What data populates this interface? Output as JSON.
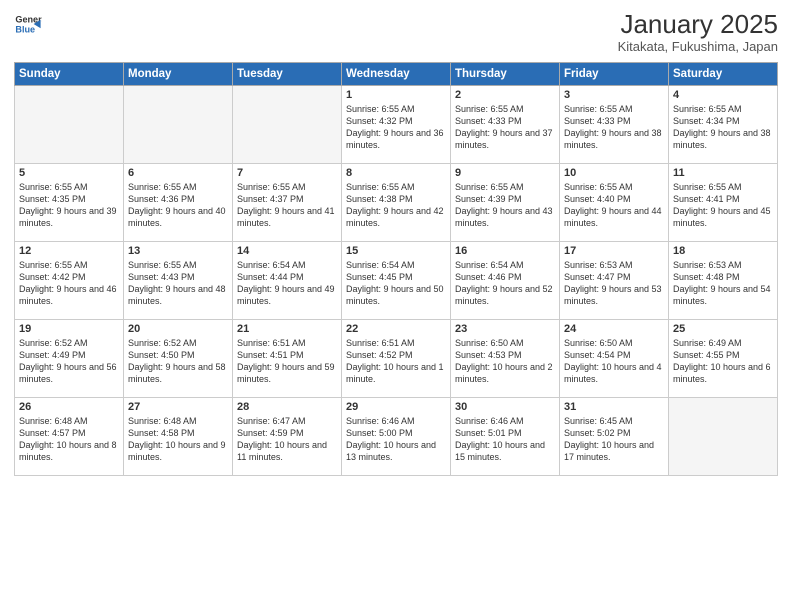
{
  "header": {
    "logo_general": "General",
    "logo_blue": "Blue",
    "title": "January 2025",
    "subtitle": "Kitakata, Fukushima, Japan"
  },
  "days_of_week": [
    "Sunday",
    "Monday",
    "Tuesday",
    "Wednesday",
    "Thursday",
    "Friday",
    "Saturday"
  ],
  "weeks": [
    [
      {
        "day": "",
        "content": ""
      },
      {
        "day": "",
        "content": ""
      },
      {
        "day": "",
        "content": ""
      },
      {
        "day": "1",
        "content": "Sunrise: 6:55 AM\nSunset: 4:32 PM\nDaylight: 9 hours and 36 minutes."
      },
      {
        "day": "2",
        "content": "Sunrise: 6:55 AM\nSunset: 4:33 PM\nDaylight: 9 hours and 37 minutes."
      },
      {
        "day": "3",
        "content": "Sunrise: 6:55 AM\nSunset: 4:33 PM\nDaylight: 9 hours and 38 minutes."
      },
      {
        "day": "4",
        "content": "Sunrise: 6:55 AM\nSunset: 4:34 PM\nDaylight: 9 hours and 38 minutes."
      }
    ],
    [
      {
        "day": "5",
        "content": "Sunrise: 6:55 AM\nSunset: 4:35 PM\nDaylight: 9 hours and 39 minutes."
      },
      {
        "day": "6",
        "content": "Sunrise: 6:55 AM\nSunset: 4:36 PM\nDaylight: 9 hours and 40 minutes."
      },
      {
        "day": "7",
        "content": "Sunrise: 6:55 AM\nSunset: 4:37 PM\nDaylight: 9 hours and 41 minutes."
      },
      {
        "day": "8",
        "content": "Sunrise: 6:55 AM\nSunset: 4:38 PM\nDaylight: 9 hours and 42 minutes."
      },
      {
        "day": "9",
        "content": "Sunrise: 6:55 AM\nSunset: 4:39 PM\nDaylight: 9 hours and 43 minutes."
      },
      {
        "day": "10",
        "content": "Sunrise: 6:55 AM\nSunset: 4:40 PM\nDaylight: 9 hours and 44 minutes."
      },
      {
        "day": "11",
        "content": "Sunrise: 6:55 AM\nSunset: 4:41 PM\nDaylight: 9 hours and 45 minutes."
      }
    ],
    [
      {
        "day": "12",
        "content": "Sunrise: 6:55 AM\nSunset: 4:42 PM\nDaylight: 9 hours and 46 minutes."
      },
      {
        "day": "13",
        "content": "Sunrise: 6:55 AM\nSunset: 4:43 PM\nDaylight: 9 hours and 48 minutes."
      },
      {
        "day": "14",
        "content": "Sunrise: 6:54 AM\nSunset: 4:44 PM\nDaylight: 9 hours and 49 minutes."
      },
      {
        "day": "15",
        "content": "Sunrise: 6:54 AM\nSunset: 4:45 PM\nDaylight: 9 hours and 50 minutes."
      },
      {
        "day": "16",
        "content": "Sunrise: 6:54 AM\nSunset: 4:46 PM\nDaylight: 9 hours and 52 minutes."
      },
      {
        "day": "17",
        "content": "Sunrise: 6:53 AM\nSunset: 4:47 PM\nDaylight: 9 hours and 53 minutes."
      },
      {
        "day": "18",
        "content": "Sunrise: 6:53 AM\nSunset: 4:48 PM\nDaylight: 9 hours and 54 minutes."
      }
    ],
    [
      {
        "day": "19",
        "content": "Sunrise: 6:52 AM\nSunset: 4:49 PM\nDaylight: 9 hours and 56 minutes."
      },
      {
        "day": "20",
        "content": "Sunrise: 6:52 AM\nSunset: 4:50 PM\nDaylight: 9 hours and 58 minutes."
      },
      {
        "day": "21",
        "content": "Sunrise: 6:51 AM\nSunset: 4:51 PM\nDaylight: 9 hours and 59 minutes."
      },
      {
        "day": "22",
        "content": "Sunrise: 6:51 AM\nSunset: 4:52 PM\nDaylight: 10 hours and 1 minute."
      },
      {
        "day": "23",
        "content": "Sunrise: 6:50 AM\nSunset: 4:53 PM\nDaylight: 10 hours and 2 minutes."
      },
      {
        "day": "24",
        "content": "Sunrise: 6:50 AM\nSunset: 4:54 PM\nDaylight: 10 hours and 4 minutes."
      },
      {
        "day": "25",
        "content": "Sunrise: 6:49 AM\nSunset: 4:55 PM\nDaylight: 10 hours and 6 minutes."
      }
    ],
    [
      {
        "day": "26",
        "content": "Sunrise: 6:48 AM\nSunset: 4:57 PM\nDaylight: 10 hours and 8 minutes."
      },
      {
        "day": "27",
        "content": "Sunrise: 6:48 AM\nSunset: 4:58 PM\nDaylight: 10 hours and 9 minutes."
      },
      {
        "day": "28",
        "content": "Sunrise: 6:47 AM\nSunset: 4:59 PM\nDaylight: 10 hours and 11 minutes."
      },
      {
        "day": "29",
        "content": "Sunrise: 6:46 AM\nSunset: 5:00 PM\nDaylight: 10 hours and 13 minutes."
      },
      {
        "day": "30",
        "content": "Sunrise: 6:46 AM\nSunset: 5:01 PM\nDaylight: 10 hours and 15 minutes."
      },
      {
        "day": "31",
        "content": "Sunrise: 6:45 AM\nSunset: 5:02 PM\nDaylight: 10 hours and 17 minutes."
      },
      {
        "day": "",
        "content": ""
      }
    ]
  ]
}
